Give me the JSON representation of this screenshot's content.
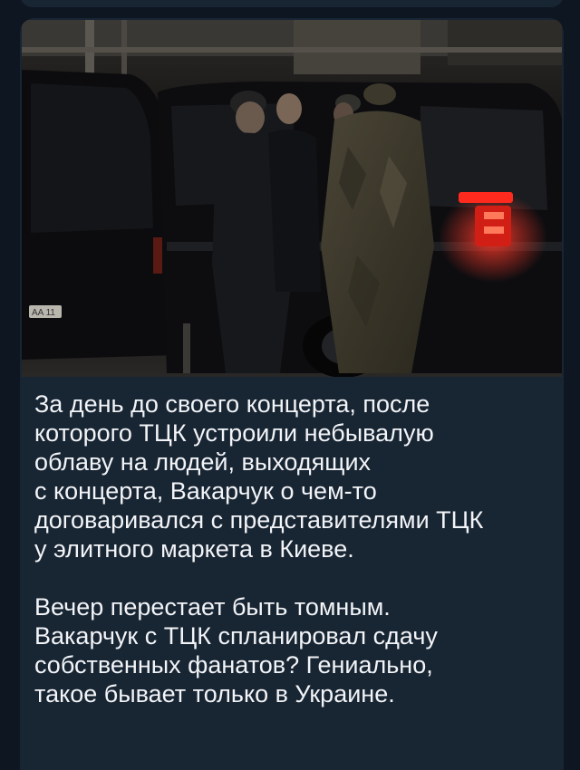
{
  "post": {
    "photo": {
      "subject": "night photo: men in dark clothing and camouflage uniforms beside black SUVs",
      "car_plate": "AA 11"
    },
    "caption": {
      "paragraph1": "За день до своего концерта, после\nкоторого ТЦК устроили небывалую\nоблаву на людей, выходящих\nс концерта, Вакарчук о чем-то\nдоговаривался с представителями ТЦК\nу элитного маркета в Киеве.",
      "paragraph2": "Вечер перестает быть томным.\nВакарчук с ТЦК спланировал сдачу\nсобственных фанатов? Гениально,\nтакое бывает только в Украине."
    }
  },
  "colors": {
    "background": "#0e1621",
    "bubble": "#182533",
    "text": "#f2f4f7",
    "taillight": "#ff3a2a"
  }
}
